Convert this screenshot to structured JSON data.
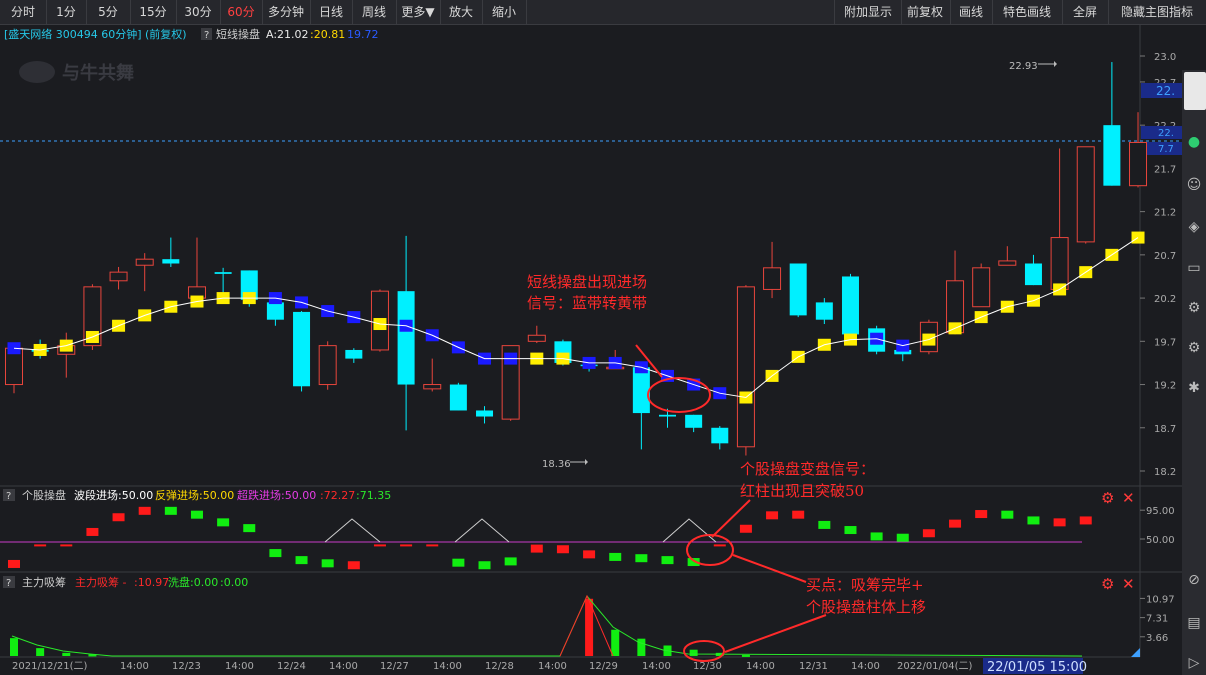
{
  "toolbar": {
    "items": [
      {
        "label": "分时",
        "active": false
      },
      {
        "label": "1分",
        "active": false
      },
      {
        "label": "5分",
        "active": false
      },
      {
        "label": "15分",
        "active": false
      },
      {
        "label": "30分",
        "active": false
      },
      {
        "label": "60分",
        "active": true
      },
      {
        "label": "多分钟",
        "active": false
      },
      {
        "label": "日线",
        "active": false
      },
      {
        "label": "周线",
        "active": false
      },
      {
        "label": "更多▼",
        "active": false
      },
      {
        "label": "放大",
        "active": false
      },
      {
        "label": "缩小",
        "active": false
      }
    ],
    "right_items": [
      "附加显示",
      "前复权",
      "画线",
      "特色画线",
      "全屏",
      "隐藏主图指标"
    ]
  },
  "main_panel": {
    "stock": "[盛天网络 300494 60分钟]",
    "adj": "(前复权)",
    "indicator": "短线操盘",
    "a_label": "A:21.02",
    "b_value": ":20.81",
    "c_value": "19.72",
    "watermark": "与牛共舞",
    "high_marker": "22.93",
    "low_marker": "18.36",
    "price_tag_top": "22.",
    "price_tag_mid": "22.",
    "price_tag_pct": "7.7",
    "annotation": [
      "短线操盘出现进场",
      "信号：蓝带转黄带"
    ]
  },
  "panel2": {
    "name": "个股操盘",
    "l1": "波段进场:50.00",
    "l2": "反弹进场:50.00",
    "l3": "超跌进场:50.00",
    "v1": ":72.27",
    "v2": ":71.35",
    "annotation": [
      "个股操盘变盘信号：",
      "红柱出现且突破50"
    ]
  },
  "panel3": {
    "name": "主力吸筹",
    "l1": "主力吸筹 -",
    "v1": ":10.97",
    "l2": "洗盘:0.00",
    "v2": ":0.00",
    "annotation": [
      "买点：吸筹完毕+",
      "个股操盘柱体上移"
    ]
  },
  "x_axis": {
    "labels": [
      "2021/12/21(二)",
      "14:00",
      "12/23",
      "14:00",
      "12/24",
      "14:00",
      "12/27",
      "14:00",
      "12/28",
      "14:00",
      "12/29",
      "14:00",
      "12/30",
      "14:00",
      "12/31",
      "14:00",
      "2022/01/04(二)"
    ],
    "cursor": "22/01/05 15:00"
  },
  "chart_data": [
    {
      "type": "candlestick",
      "title": "短线操盘",
      "y_ticks": [
        "23.0",
        "22.7",
        "22.2",
        "21.7",
        "21.2",
        "20.7",
        "20.2",
        "19.7",
        "19.2",
        "18.7",
        "18.2"
      ],
      "ylim": [
        18.2,
        23.0
      ],
      "candles": [
        {
          "o": 19.2,
          "c": 19.62,
          "h": 19.65,
          "l": 19.1
        },
        {
          "o": 19.6,
          "c": 19.58,
          "h": 19.72,
          "l": 19.5
        },
        {
          "o": 19.55,
          "c": 19.65,
          "h": 19.8,
          "l": 19.28
        },
        {
          "o": 19.65,
          "c": 20.33,
          "h": 20.36,
          "l": 19.6
        },
        {
          "o": 20.4,
          "c": 20.5,
          "h": 20.56,
          "l": 20.3
        },
        {
          "o": 20.58,
          "c": 20.65,
          "h": 20.72,
          "l": 20.28
        },
        {
          "o": 20.65,
          "c": 20.6,
          "h": 20.9,
          "l": 20.56
        },
        {
          "o": 20.2,
          "c": 20.33,
          "h": 20.9,
          "l": 20.2
        },
        {
          "o": 20.5,
          "c": 20.48,
          "h": 20.55,
          "l": 20.25
        },
        {
          "o": 20.52,
          "c": 20.18,
          "h": 20.52,
          "l": 20.1
        },
        {
          "o": 20.15,
          "c": 19.95,
          "h": 20.17,
          "l": 19.88
        },
        {
          "o": 20.04,
          "c": 19.18,
          "h": 20.05,
          "l": 19.12
        },
        {
          "o": 19.2,
          "c": 19.65,
          "h": 19.7,
          "l": 19.14
        },
        {
          "o": 19.6,
          "c": 19.5,
          "h": 19.62,
          "l": 19.45
        },
        {
          "o": 19.6,
          "c": 20.28,
          "h": 20.3,
          "l": 19.58
        },
        {
          "o": 20.28,
          "c": 19.2,
          "h": 20.92,
          "l": 18.67
        },
        {
          "o": 19.15,
          "c": 19.2,
          "h": 19.5,
          "l": 19.12
        },
        {
          "o": 19.2,
          "c": 18.9,
          "h": 19.22,
          "l": 18.9
        },
        {
          "o": 18.9,
          "c": 18.83,
          "h": 18.95,
          "l": 18.75
        },
        {
          "o": 18.8,
          "c": 19.65,
          "h": 19.65,
          "l": 18.78
        },
        {
          "o": 19.7,
          "c": 19.77,
          "h": 19.88,
          "l": 19.68
        },
        {
          "o": 19.7,
          "c": 19.45,
          "h": 19.72,
          "l": 19.42
        },
        {
          "o": 19.43,
          "c": 19.42,
          "h": 19.5,
          "l": 19.35
        },
        {
          "o": 19.4,
          "c": 19.4,
          "h": 19.6,
          "l": 19.38
        },
        {
          "o": 19.4,
          "c": 18.87,
          "h": 19.45,
          "l": 18.45
        },
        {
          "o": 18.85,
          "c": 18.83,
          "h": 18.92,
          "l": 18.7
        },
        {
          "o": 18.85,
          "c": 18.7,
          "h": 18.85,
          "l": 18.65
        },
        {
          "o": 18.7,
          "c": 18.52,
          "h": 18.72,
          "l": 18.45
        },
        {
          "o": 18.48,
          "c": 20.33,
          "h": 20.35,
          "l": 18.38
        },
        {
          "o": 20.3,
          "c": 20.55,
          "h": 20.85,
          "l": 20.2
        },
        {
          "o": 20.6,
          "c": 20.0,
          "h": 20.6,
          "l": 19.98
        },
        {
          "o": 20.15,
          "c": 19.95,
          "h": 20.2,
          "l": 19.9
        },
        {
          "o": 20.45,
          "c": 19.78,
          "h": 20.48,
          "l": 19.75
        },
        {
          "o": 19.85,
          "c": 19.58,
          "h": 19.88,
          "l": 19.55
        },
        {
          "o": 19.6,
          "c": 19.55,
          "h": 19.65,
          "l": 19.47
        },
        {
          "o": 19.58,
          "c": 19.92,
          "h": 19.95,
          "l": 19.55
        },
        {
          "o": 19.8,
          "c": 20.4,
          "h": 20.75,
          "l": 19.78
        },
        {
          "o": 20.1,
          "c": 20.55,
          "h": 20.6,
          "l": 20.1
        },
        {
          "o": 20.58,
          "c": 20.63,
          "h": 20.8,
          "l": 20.58
        },
        {
          "o": 20.6,
          "c": 20.35,
          "h": 20.7,
          "l": 20.35
        },
        {
          "o": 20.3,
          "c": 20.9,
          "h": 21.93,
          "l": 20.28
        },
        {
          "o": 20.85,
          "c": 21.95,
          "h": 21.95,
          "l": 20.83
        },
        {
          "o": 22.2,
          "c": 21.5,
          "h": 22.93,
          "l": 21.5
        },
        {
          "o": 21.5,
          "c": 22.0,
          "h": 22.35,
          "l": 21.48
        }
      ],
      "band": [
        {
          "v": 19.62,
          "c": "blue"
        },
        {
          "v": 19.6,
          "c": "yellow"
        },
        {
          "v": 19.65,
          "c": "yellow"
        },
        {
          "v": 19.75,
          "c": "yellow"
        },
        {
          "v": 19.88,
          "c": "yellow"
        },
        {
          "v": 20.0,
          "c": "yellow"
        },
        {
          "v": 20.1,
          "c": "yellow"
        },
        {
          "v": 20.16,
          "c": "yellow"
        },
        {
          "v": 20.2,
          "c": "yellow"
        },
        {
          "v": 20.2,
          "c": "yellow"
        },
        {
          "v": 20.2,
          "c": "blue"
        },
        {
          "v": 20.15,
          "c": "blue"
        },
        {
          "v": 20.05,
          "c": "blue"
        },
        {
          "v": 19.98,
          "c": "blue"
        },
        {
          "v": 19.9,
          "c": "yellow"
        },
        {
          "v": 19.88,
          "c": "blue"
        },
        {
          "v": 19.77,
          "c": "blue"
        },
        {
          "v": 19.63,
          "c": "blue"
        },
        {
          "v": 19.5,
          "c": "blue"
        },
        {
          "v": 19.5,
          "c": "blue"
        },
        {
          "v": 19.5,
          "c": "yellow"
        },
        {
          "v": 19.5,
          "c": "yellow"
        },
        {
          "v": 19.45,
          "c": "blue"
        },
        {
          "v": 19.45,
          "c": "blue"
        },
        {
          "v": 19.4,
          "c": "blue"
        },
        {
          "v": 19.3,
          "c": "blue"
        },
        {
          "v": 19.2,
          "c": "blue"
        },
        {
          "v": 19.1,
          "c": "blue"
        },
        {
          "v": 19.05,
          "c": "yellow"
        },
        {
          "v": 19.3,
          "c": "yellow"
        },
        {
          "v": 19.52,
          "c": "yellow"
        },
        {
          "v": 19.66,
          "c": "yellow"
        },
        {
          "v": 19.72,
          "c": "yellow"
        },
        {
          "v": 19.73,
          "c": "blue"
        },
        {
          "v": 19.65,
          "c": "blue"
        },
        {
          "v": 19.72,
          "c": "yellow"
        },
        {
          "v": 19.85,
          "c": "yellow"
        },
        {
          "v": 19.98,
          "c": "yellow"
        },
        {
          "v": 20.1,
          "c": "yellow"
        },
        {
          "v": 20.17,
          "c": "yellow"
        },
        {
          "v": 20.3,
          "c": "yellow"
        },
        {
          "v": 20.5,
          "c": "yellow"
        },
        {
          "v": 20.7,
          "c": "yellow"
        },
        {
          "v": 20.9,
          "c": "yellow"
        }
      ]
    },
    {
      "type": "bar",
      "title": "个股操盘",
      "y_ticks": [
        "95.00",
        "50.00"
      ],
      "ylim": [
        0,
        100
      ],
      "values": [
        {
          "v": 11,
          "c": "red"
        },
        {
          "v": 40,
          "c": "red"
        },
        {
          "v": 40,
          "c": "red"
        },
        {
          "v": 61,
          "c": "red"
        },
        {
          "v": 84,
          "c": "red"
        },
        {
          "v": 94,
          "c": "red"
        },
        {
          "v": 94,
          "c": "green"
        },
        {
          "v": 88,
          "c": "green"
        },
        {
          "v": 76,
          "c": "green"
        },
        {
          "v": 67,
          "c": "green"
        },
        {
          "v": 28,
          "c": "green"
        },
        {
          "v": 17,
          "c": "green"
        },
        {
          "v": 12,
          "c": "green"
        },
        {
          "v": 9,
          "c": "red"
        },
        {
          "v": 40,
          "c": "red"
        },
        {
          "v": 40,
          "c": "red"
        },
        {
          "v": 40,
          "c": "red"
        },
        {
          "v": 13,
          "c": "green"
        },
        {
          "v": 9,
          "c": "green"
        },
        {
          "v": 15,
          "c": "green"
        },
        {
          "v": 35,
          "c": "red"
        },
        {
          "v": 34,
          "c": "red"
        },
        {
          "v": 26,
          "c": "red"
        },
        {
          "v": 22,
          "c": "green"
        },
        {
          "v": 20,
          "c": "green"
        },
        {
          "v": 17,
          "c": "green"
        },
        {
          "v": 14,
          "c": "green"
        },
        {
          "v": 40,
          "c": "red"
        },
        {
          "v": 66,
          "c": "red"
        },
        {
          "v": 87,
          "c": "red"
        },
        {
          "v": 88,
          "c": "red"
        },
        {
          "v": 72,
          "c": "green"
        },
        {
          "v": 64,
          "c": "green"
        },
        {
          "v": 54,
          "c": "green"
        },
        {
          "v": 52,
          "c": "green"
        },
        {
          "v": 59,
          "c": "red"
        },
        {
          "v": 74,
          "c": "red"
        },
        {
          "v": 89,
          "c": "red"
        },
        {
          "v": 88,
          "c": "green"
        },
        {
          "v": 79,
          "c": "green"
        },
        {
          "v": 76,
          "c": "red"
        },
        {
          "v": 79,
          "c": "red"
        }
      ]
    },
    {
      "type": "bar",
      "title": "主力吸筹",
      "y_ticks": [
        "10.97",
        "7.31",
        "3.66"
      ],
      "ylim": [
        0,
        12
      ],
      "values": [
        {
          "v": 3.4,
          "c": "green"
        },
        {
          "v": 1.5,
          "c": "green"
        },
        {
          "v": 0.6,
          "c": "green"
        },
        {
          "v": 0.3,
          "c": "green"
        },
        {
          "v": 10.9,
          "c": "red"
        },
        {
          "v": 5.0,
          "c": "green"
        },
        {
          "v": 3.3,
          "c": "green"
        },
        {
          "v": 2.0,
          "c": "green"
        },
        {
          "v": 1.2,
          "c": "green"
        },
        {
          "v": 0.6,
          "c": "green"
        },
        {
          "v": 0.2,
          "c": "green"
        }
      ]
    }
  ]
}
